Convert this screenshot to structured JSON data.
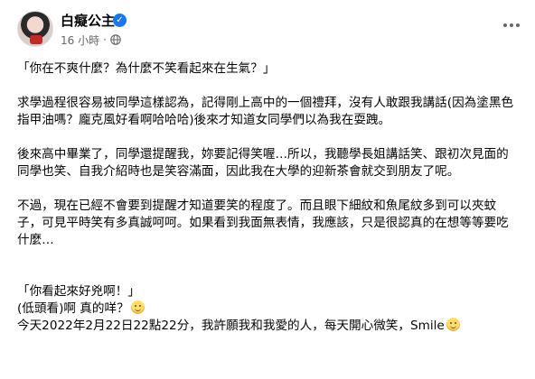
{
  "post": {
    "author_name": "白癡公主",
    "timestamp": "16 小時",
    "separator": "·",
    "paragraphs": [
      "「你在不爽什麼？為什麼不笑看起來在生氣？」",
      "求學過程很容易被同學這樣認為，記得剛上高中的一個禮拜，沒有人敢跟我講話(因為塗黑色指甲油嗎？龐克風好看啊哈哈哈)後來才知道女同學們以為我在耍跩。",
      "後來高中畢業了，同學還提醒我，妳要記得笑喔…所以，我聽學長姐講話笑、跟初次見面的同學也笑、自我介紹時也是笑容滿面，因此我在大學的迎新茶會就交到朋友了呢。",
      "不過，現在已經不會要到提醒才知道要笑的程度了。而且眼下細紋和魚尾紋多到可以夾蚊子，可見平時笑有多真誠呵呵。如果看到我面無表情，我應該，只是很認真的在想等等要吃什麼…",
      "「你看起來好兇啊！」",
      "(低頭看)啊 真的咩？",
      "今天2022年2月22日22點22分，我許願我和我愛的人，每天開心微笑，Smile"
    ]
  },
  "icons": {
    "verified": "verified-badge-icon",
    "audience": "globe-icon",
    "more": "more-options-icon",
    "emoji_1": "smiling-face-with-blush-emoji",
    "emoji_2": "grinning-face-emoji"
  },
  "colors": {
    "text_primary": "#050505",
    "text_secondary": "#65676b",
    "verified_blue": "#1877f2",
    "background": "#ffffff"
  }
}
